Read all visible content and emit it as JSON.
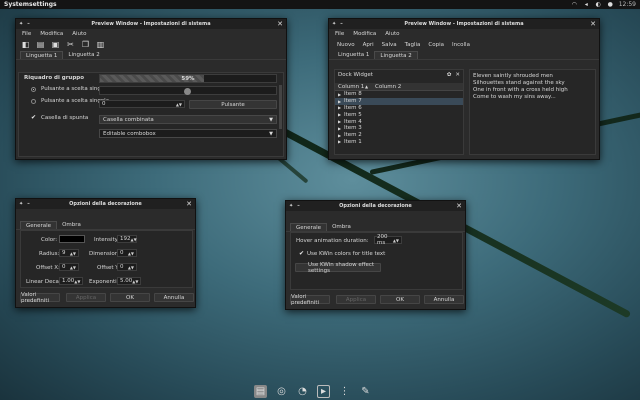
{
  "panel": {
    "title": "Systemsettings",
    "clock": "12:59"
  },
  "win1": {
    "title": "Preview Window - Impostazioni di sistema",
    "menu": [
      "File",
      "Modifica",
      "Aiuto"
    ],
    "tabs": [
      "Linguetta 1",
      "Linguetta 2"
    ],
    "group_title": "Riquadro di gruppo",
    "radio1": "Pulsante a scelta singola",
    "radio2": "Pulsante a scelta singola",
    "progress": "59%",
    "progress_fraction": 0.59,
    "spin_value": "0",
    "button": "Pulsante",
    "checkbox": "Casella di spunta",
    "combo": "Casella combinata",
    "editable": "Editable combobox"
  },
  "win2": {
    "title": "Preview Window - Impostazioni di sistema",
    "menu": [
      "File",
      "Modifica",
      "Aiuto"
    ],
    "toolbar": [
      "Nuovo",
      "Apri",
      "Salva",
      "Taglia",
      "Copia",
      "Incolla"
    ],
    "tabs": [
      "Linguetta 1",
      "Linguetta 2"
    ],
    "dock_title": "Dock Widget",
    "col1": "Column 1",
    "col2": "Column 2",
    "items": [
      "Item 8",
      "Item 7",
      "Item 6",
      "Item 5",
      "Item 4",
      "Item 3",
      "Item 2",
      "Item 1"
    ],
    "text": [
      "Eleven saintly shrouded men",
      "Silhouettes stand against the sky",
      "One in front with a cross held high",
      "Come to wash my sins away..."
    ]
  },
  "win3": {
    "title": "Opzioni della decorazione",
    "tabs": [
      "Generale",
      "Ombra"
    ],
    "color_label": "Color:",
    "intensity_label": "Intensity:",
    "intensity": "192",
    "radius_label": "Radius:",
    "radius": "9",
    "dimension_label": "Dimensione:",
    "dimension": "0",
    "offx_label": "Offset X:",
    "offx": "0",
    "offy_label": "Offset Y:",
    "offy": "0",
    "decay_label": "Linear Decay:",
    "decay": "1.00",
    "exp_label": "Exponential:",
    "exp": "5.00",
    "defaults": "Valori predefiniti",
    "apply": "Applica",
    "ok": "OK",
    "cancel": "Annulla"
  },
  "win4": {
    "title": "Opzioni della decorazione",
    "tabs": [
      "Generale",
      "Ombra"
    ],
    "hover_label": "Hover animation duration:",
    "hover_value": "200 ms",
    "check1": "Use KWin colors for title text",
    "check2": "Use KWin shadow effect settings",
    "defaults": "Valori predefiniti",
    "apply": "Applica",
    "ok": "OK",
    "cancel": "Annulla"
  },
  "colors": {
    "window": "#2b2b2b",
    "titlebar": "#202020",
    "selection": "#3a4a58"
  }
}
